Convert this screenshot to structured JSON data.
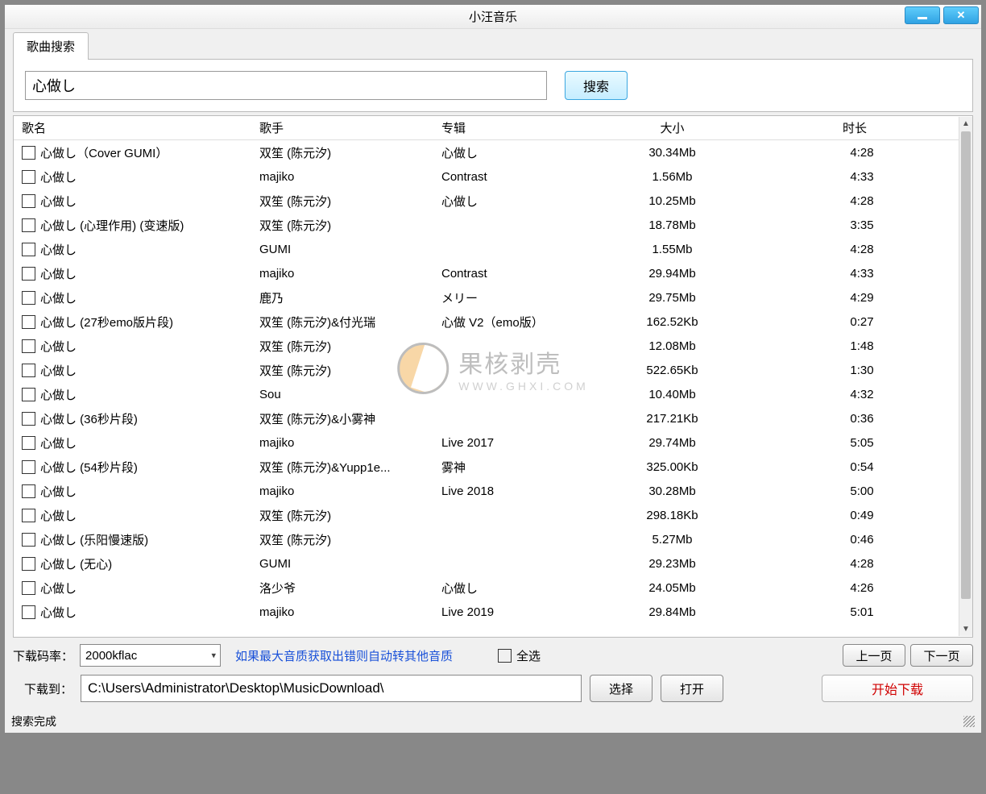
{
  "window": {
    "title": "小汪音乐"
  },
  "tab": {
    "label": "歌曲搜索"
  },
  "search": {
    "value": "心做し",
    "button": "搜索"
  },
  "columns": {
    "name": "歌名",
    "artist": "歌手",
    "album": "专辑",
    "size": "大小",
    "duration": "时长"
  },
  "rows": [
    {
      "name": "心做し（Cover GUMI）",
      "artist": "双笙 (陈元汐)",
      "album": "心做し",
      "size": "30.34Mb",
      "duration": "4:28"
    },
    {
      "name": "心做し",
      "artist": "majiko",
      "album": "Contrast",
      "size": "1.56Mb",
      "duration": "4:33"
    },
    {
      "name": "心做し",
      "artist": "双笙 (陈元汐)",
      "album": "心做し",
      "size": "10.25Mb",
      "duration": "4:28"
    },
    {
      "name": "心做し (心理作用) (变速版)",
      "artist": "双笙 (陈元汐)",
      "album": "",
      "size": "18.78Mb",
      "duration": "3:35"
    },
    {
      "name": "心做し",
      "artist": "GUMI",
      "album": "",
      "size": "1.55Mb",
      "duration": "4:28"
    },
    {
      "name": "心做し",
      "artist": "majiko",
      "album": "Contrast",
      "size": "29.94Mb",
      "duration": "4:33"
    },
    {
      "name": "心做し",
      "artist": "鹿乃",
      "album": "メリー",
      "size": "29.75Mb",
      "duration": "4:29"
    },
    {
      "name": "心做し (27秒emo版片段)",
      "artist": "双笙 (陈元汐)&付光瑞",
      "album": "心做 V2（emo版）",
      "size": "162.52Kb",
      "duration": "0:27"
    },
    {
      "name": "心做し",
      "artist": "双笙 (陈元汐)",
      "album": "",
      "size": "12.08Mb",
      "duration": "1:48"
    },
    {
      "name": "心做し",
      "artist": "双笙 (陈元汐)",
      "album": "",
      "size": "522.65Kb",
      "duration": "1:30"
    },
    {
      "name": "心做し",
      "artist": "Sou",
      "album": "",
      "size": "10.40Mb",
      "duration": "4:32"
    },
    {
      "name": "心做し (36秒片段)",
      "artist": "双笙 (陈元汐)&小雾神",
      "album": "",
      "size": "217.21Kb",
      "duration": "0:36"
    },
    {
      "name": "心做し",
      "artist": "majiko",
      "album": "Live 2017",
      "size": "29.74Mb",
      "duration": "5:05"
    },
    {
      "name": "心做し (54秒片段)",
      "artist": "双笙 (陈元汐)&Yupp1e...",
      "album": "雾神",
      "size": "325.00Kb",
      "duration": "0:54"
    },
    {
      "name": "心做し",
      "artist": "majiko",
      "album": "Live 2018",
      "size": "30.28Mb",
      "duration": "5:00"
    },
    {
      "name": "心做し",
      "artist": "双笙 (陈元汐)",
      "album": "",
      "size": "298.18Kb",
      "duration": "0:49"
    },
    {
      "name": "心做し (乐阳慢速版)",
      "artist": "双笙 (陈元汐)",
      "album": "",
      "size": "5.27Mb",
      "duration": "0:46"
    },
    {
      "name": "心做し (无心)",
      "artist": "GUMI",
      "album": "",
      "size": "29.23Mb",
      "duration": "4:28"
    },
    {
      "name": "心做し",
      "artist": "洛少爷",
      "album": "心做し",
      "size": "24.05Mb",
      "duration": "4:26"
    },
    {
      "name": "心做し",
      "artist": "majiko",
      "album": "Live 2019",
      "size": "29.84Mb",
      "duration": "5:01"
    }
  ],
  "bitrate": {
    "label": "下载码率：",
    "value": "2000kflac",
    "note": "如果最大音质获取出错则自动转其他音质"
  },
  "selectAll": "全选",
  "nav": {
    "prev": "上一页",
    "next": "下一页"
  },
  "download": {
    "label": "下载到：",
    "path": "C:\\Users\\Administrator\\Desktop\\MusicDownload\\",
    "choose": "选择",
    "open": "打开",
    "start": "开始下载"
  },
  "status": "搜索完成",
  "watermark": {
    "main": "果核剥壳",
    "sub": "WWW.GHXI.COM"
  }
}
